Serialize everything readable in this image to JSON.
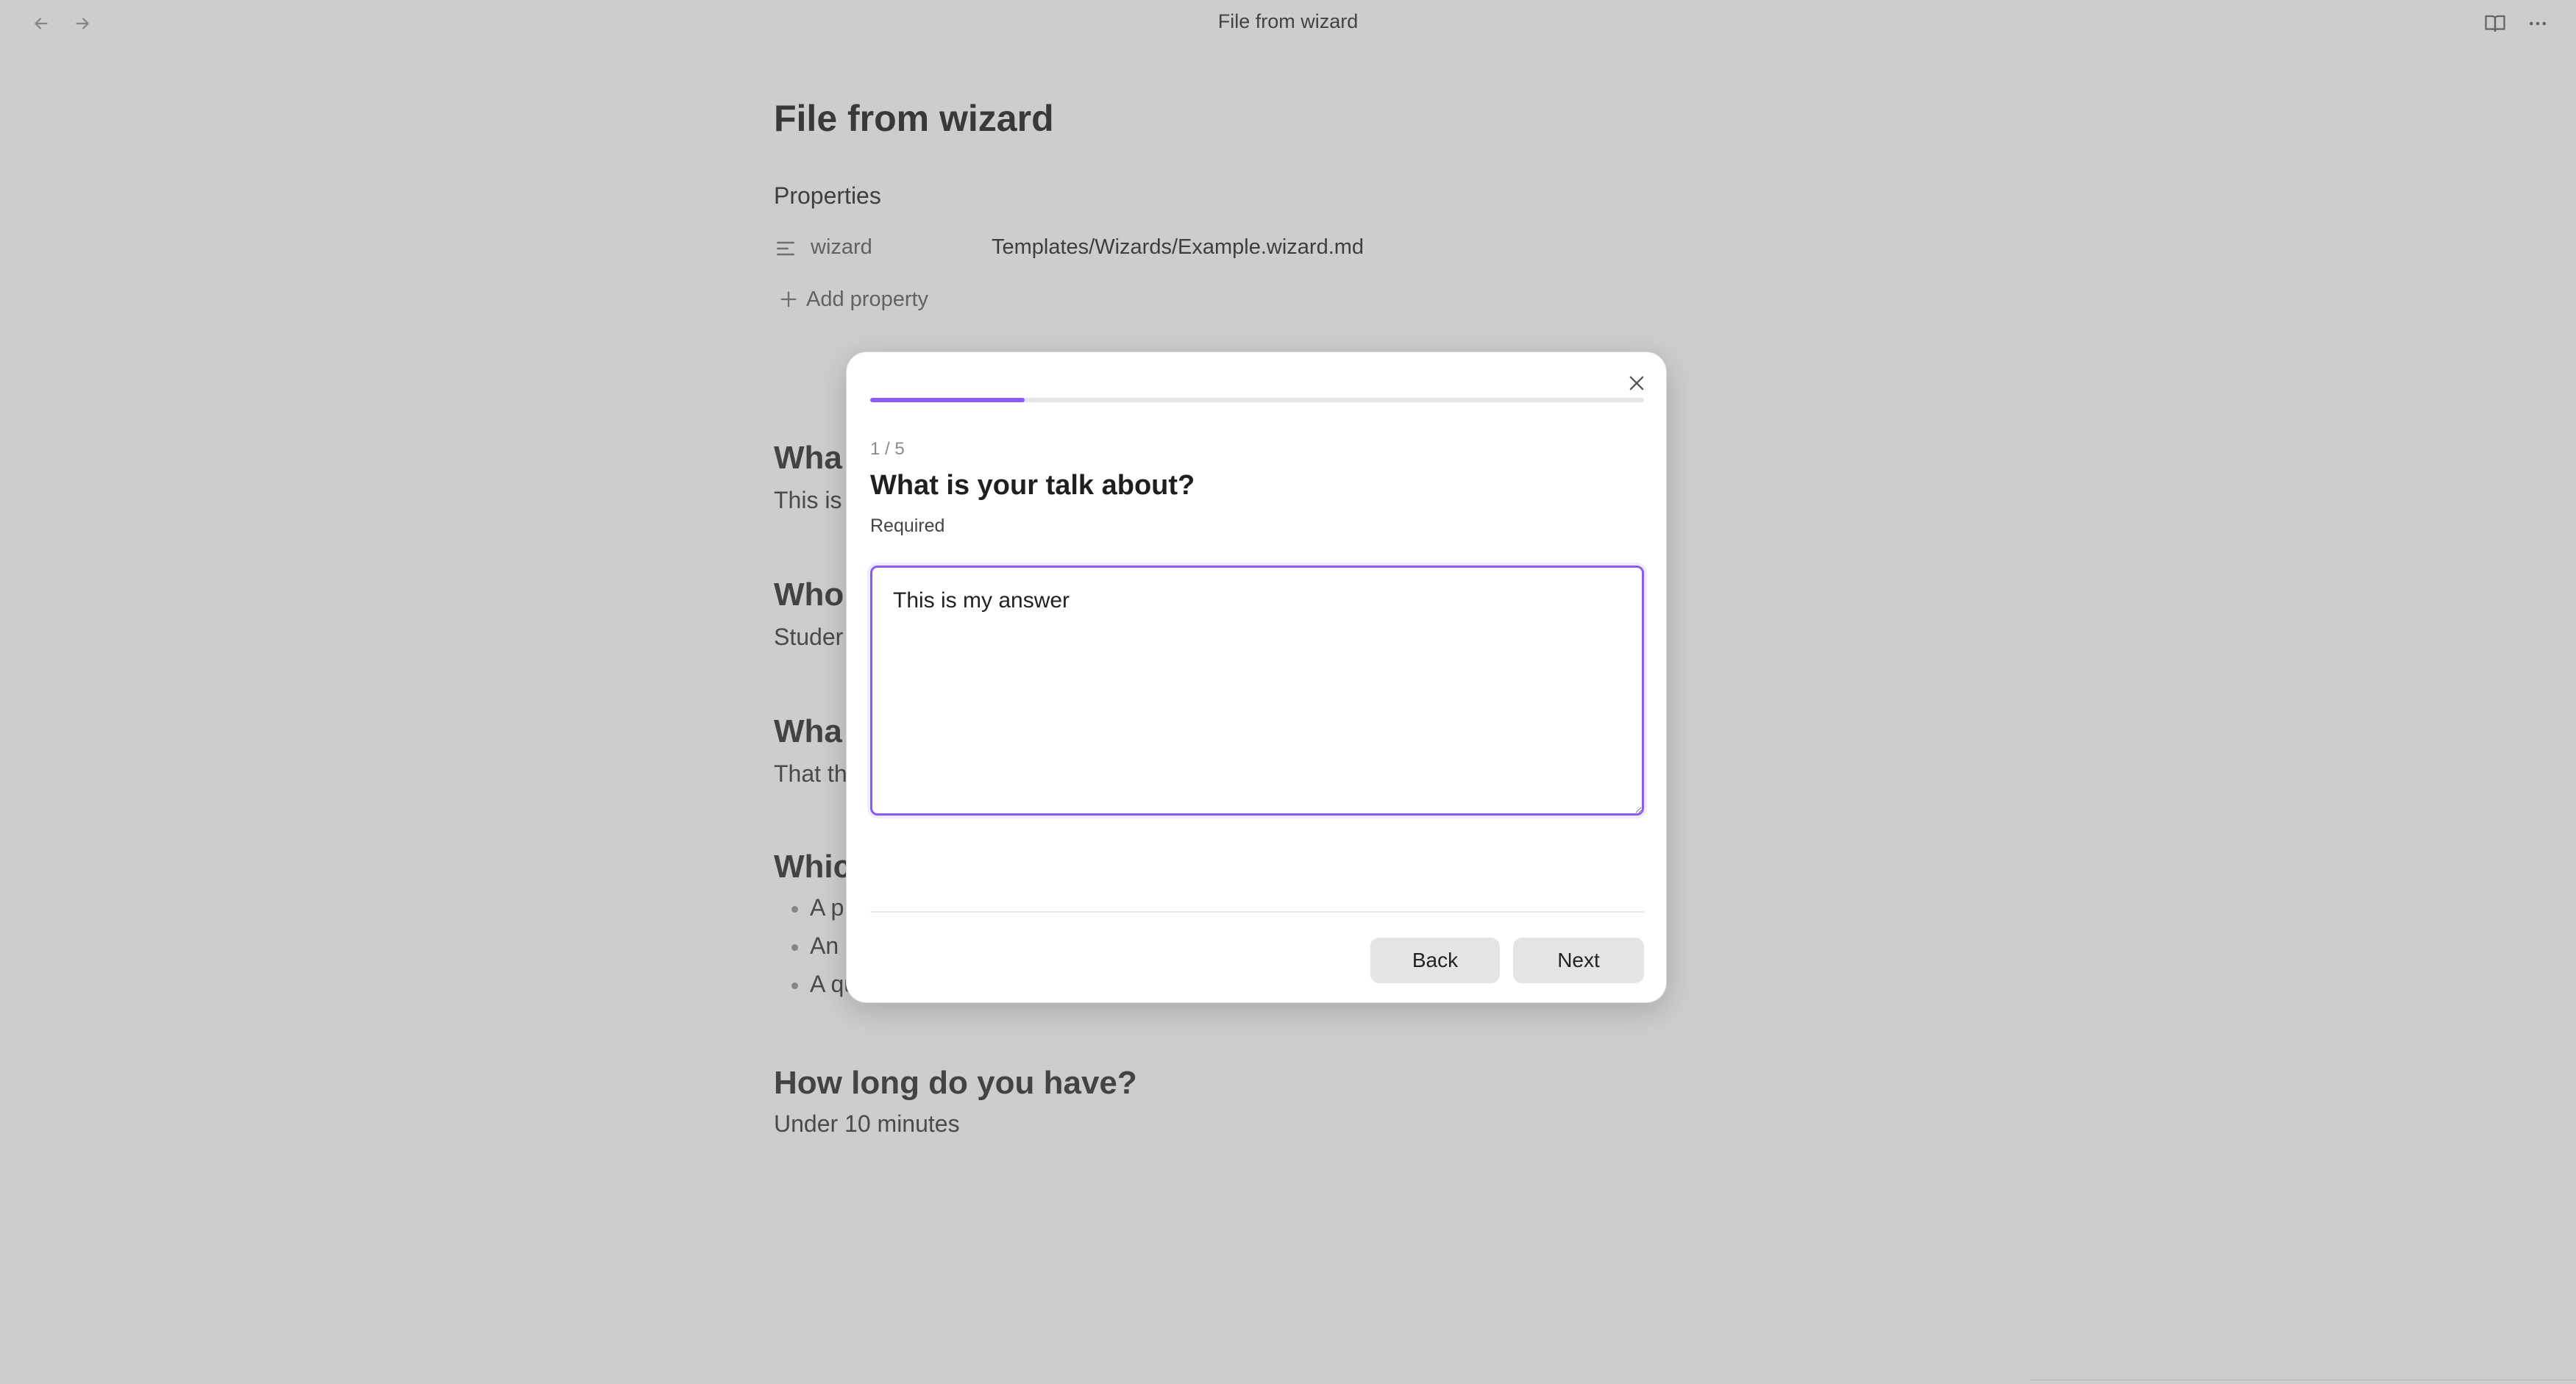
{
  "window": {
    "title": "File from wizard"
  },
  "toolbar": {
    "back_icon": "arrow-left-icon",
    "forward_icon": "arrow-right-icon",
    "reading_icon": "book-open-icon",
    "more_icon": "more-horizontal-icon"
  },
  "document": {
    "title": "File from wizard",
    "properties_heading": "Properties",
    "properties": [
      {
        "icon": "text-lines-icon",
        "key": "wizard",
        "value": "Templates/Wizards/Example.wizard.md"
      }
    ],
    "add_property_label": "Add property",
    "sections": [
      {
        "heading": "Wha",
        "body": "This is"
      },
      {
        "heading": "Who",
        "body": "Studer"
      },
      {
        "heading": "Wha",
        "body": "That th"
      },
      {
        "heading": "Whic",
        "bullets": [
          "A p",
          "An",
          "A qu"
        ]
      },
      {
        "heading": "How long do you have?",
        "body": "Under 10 minutes"
      }
    ]
  },
  "modal": {
    "progress": 0.2,
    "step_counter": "1 / 5",
    "question": "What is your talk about?",
    "required_label": "Required",
    "answer_value": "This is my answer",
    "back_label": "Back",
    "next_label": "Next",
    "close_icon": "close-icon"
  },
  "colors": {
    "accent": "#8a5cf6",
    "button_bg": "#e5e5e5",
    "overlay": "rgba(90,90,90,0.30)"
  }
}
